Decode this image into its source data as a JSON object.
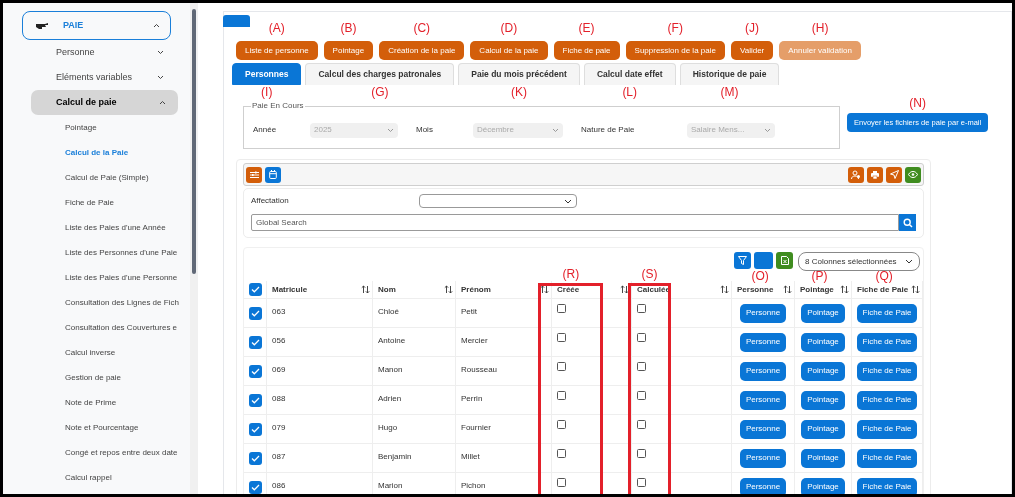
{
  "sidebar": {
    "module": {
      "label": "PAIE",
      "expanded": true
    },
    "items": [
      {
        "label": "Personne",
        "expanded": false,
        "selected": false
      },
      {
        "label": "Eléments variables",
        "expanded": false,
        "selected": false
      },
      {
        "label": "Calcul de paie",
        "expanded": true,
        "selected": true,
        "children": [
          {
            "label": "Pointage",
            "selected": false
          },
          {
            "label": "Calcul de la Paie",
            "selected": true
          },
          {
            "label": "Calcul de Paie (Simple)",
            "selected": false
          },
          {
            "label": "Fiche de Paie",
            "selected": false
          },
          {
            "label": "Liste des Paies d'une Année",
            "selected": false
          },
          {
            "label": "Liste des Personnes d'une Paie",
            "selected": false
          },
          {
            "label": "Liste des Paies d'une Personne",
            "selected": false
          },
          {
            "label": "Consultation des Lignes de Fich",
            "selected": false
          },
          {
            "label": "Consultation des Couvertures e",
            "selected": false
          },
          {
            "label": "Calcul inverse",
            "selected": false
          },
          {
            "label": "Gestion de paie",
            "selected": false
          },
          {
            "label": "Note de Prime",
            "selected": false
          },
          {
            "label": "Note et Pourcentage",
            "selected": false
          },
          {
            "label": "Congé et repos entre deux date",
            "selected": false
          },
          {
            "label": "Calcul rappel",
            "selected": false
          }
        ]
      }
    ]
  },
  "action_buttons": [
    {
      "label": "Liste de personne",
      "marker": "(A)",
      "disabled": false
    },
    {
      "label": "Pointage",
      "marker": "(B)",
      "disabled": false
    },
    {
      "label": "Création de la paie",
      "marker": "(C)",
      "disabled": false
    },
    {
      "label": "Calcul de la paie",
      "marker": "(D)",
      "disabled": false
    },
    {
      "label": "Fiche de paie",
      "marker": "(E)",
      "disabled": false
    },
    {
      "label": "Suppression de la paie",
      "marker": "(F)",
      "disabled": false
    },
    {
      "label": "Valider",
      "marker": "(J)",
      "disabled": false
    },
    {
      "label": "Annuler validation",
      "marker": "(H)",
      "disabled": true
    }
  ],
  "tabs": [
    {
      "label": "Personnes",
      "marker": "(I)",
      "selected": true
    },
    {
      "label": "Calcul des charges patronales",
      "marker": "(G)",
      "selected": false
    },
    {
      "label": "Paie du mois précédent",
      "marker": "(K)",
      "selected": false
    },
    {
      "label": "Calcul date effet",
      "marker": "(L)",
      "selected": false
    },
    {
      "label": "Historique de paie",
      "marker": "(M)",
      "selected": false
    }
  ],
  "paie_en_cours": {
    "legend": "Paie En Cours",
    "fields": [
      {
        "label": "Année",
        "value": "2025"
      },
      {
        "label": "Mois",
        "value": "Décembre"
      },
      {
        "label": "Nature de Paie",
        "value": "Salaire Mens..."
      }
    ]
  },
  "email_button": {
    "label": "Envoyer les fichiers de paie par e-mail",
    "marker": "(N)"
  },
  "filters": {
    "affectation_label": "Affectation",
    "search_placeholder": "Global Search"
  },
  "columns_select": "8 Colonnes sélectionnées",
  "table": {
    "all_checked": true,
    "columns": [
      {
        "label": "Matricule"
      },
      {
        "label": "Nom"
      },
      {
        "label": "Prénom"
      },
      {
        "label": "Créée",
        "marker": "(R)",
        "boxed": true
      },
      {
        "label": "Calculée",
        "marker": "(S)",
        "boxed": true
      },
      {
        "label": "Personne",
        "marker": "(O)"
      },
      {
        "label": "Pointage",
        "marker": "(P)"
      },
      {
        "label": "Fiche de Paie",
        "marker": "(Q)"
      }
    ],
    "rows": [
      {
        "checked": true,
        "matricule": "063",
        "nom": "Chloé",
        "prenom": "Petit",
        "creee": false,
        "calculee": false,
        "buttons": [
          "Personne",
          "Pointage",
          "Fiche de Paie"
        ]
      },
      {
        "checked": true,
        "matricule": "056",
        "nom": "Antoine",
        "prenom": "Mercier",
        "creee": false,
        "calculee": false,
        "buttons": [
          "Personne",
          "Pointage",
          "Fiche de Paie"
        ]
      },
      {
        "checked": true,
        "matricule": "069",
        "nom": "Manon",
        "prenom": "Rousseau",
        "creee": false,
        "calculee": false,
        "buttons": [
          "Personne",
          "Pointage",
          "Fiche de Paie"
        ]
      },
      {
        "checked": true,
        "matricule": "088",
        "nom": "Adrien",
        "prenom": "Perrin",
        "creee": false,
        "calculee": false,
        "buttons": [
          "Personne",
          "Pointage",
          "Fiche de Paie"
        ]
      },
      {
        "checked": true,
        "matricule": "079",
        "nom": "Hugo",
        "prenom": "Fournier",
        "creee": false,
        "calculee": false,
        "buttons": [
          "Personne",
          "Pointage",
          "Fiche de Paie"
        ]
      },
      {
        "checked": true,
        "matricule": "087",
        "nom": "Benjamin",
        "prenom": "Millet",
        "creee": false,
        "calculee": false,
        "buttons": [
          "Personne",
          "Pointage",
          "Fiche de Paie"
        ]
      },
      {
        "checked": true,
        "matricule": "086",
        "nom": "Marion",
        "prenom": "Pichon",
        "creee": false,
        "calculee": false,
        "buttons": [
          "Personne",
          "Pointage",
          "Fiche de Paie"
        ]
      }
    ]
  }
}
